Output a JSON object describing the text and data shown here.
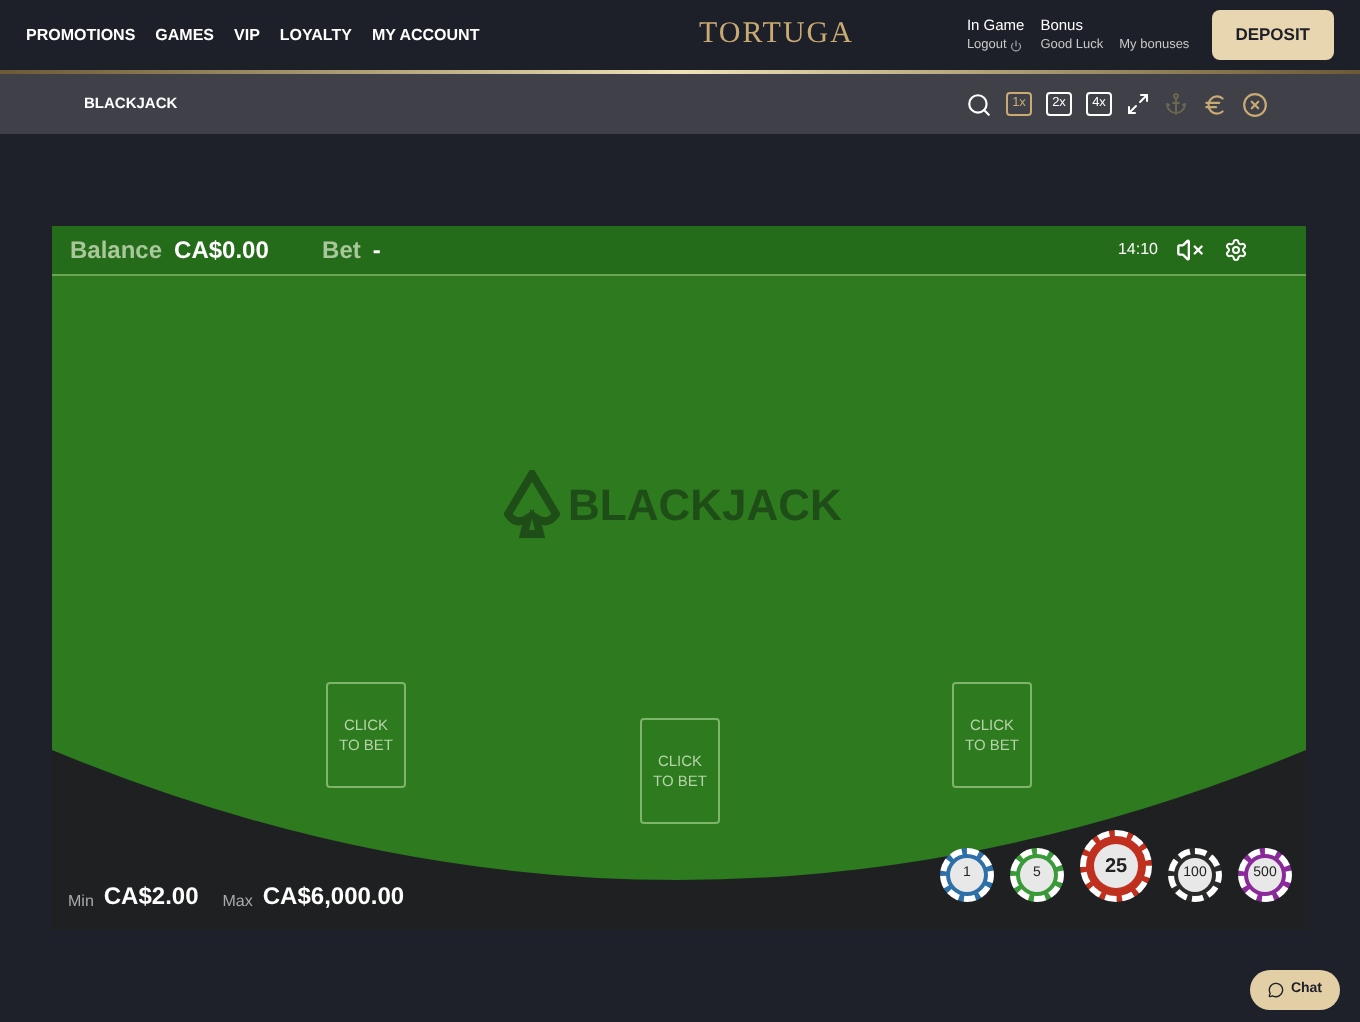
{
  "nav": {
    "links": [
      "PROMOTIONS",
      "GAMES",
      "VIP",
      "LOYALTY",
      "MY ACCOUNT"
    ],
    "logo": "TORTUGA",
    "account": [
      {
        "title": "In Game",
        "sub": "Logout"
      },
      {
        "title": "Bonus",
        "sub": "Good Luck"
      },
      {
        "sub": "My bonuses"
      }
    ],
    "deposit": "DEPOSIT"
  },
  "toolbar": {
    "title": "BLACKJACK",
    "speeds": [
      {
        "label": "1x",
        "selected": true
      },
      {
        "label": "2x",
        "selected": false
      },
      {
        "label": "4x",
        "selected": false
      }
    ]
  },
  "game": {
    "balance_label": "Balance",
    "balance": "CA$0.00",
    "bet_label": "Bet",
    "bet": "-",
    "time": "14:10",
    "logo": "BLACKJACK",
    "spots": [
      {
        "label": "CLICK TO BET"
      },
      {
        "label": "CLICK TO BET"
      },
      {
        "label": "CLICK TO BET"
      }
    ],
    "min_label": "Min",
    "min": "CA$2.00",
    "max_label": "Max",
    "max": "CA$6,000.00",
    "chips": [
      {
        "label": "1",
        "color": "#2f6fa8",
        "selected": false
      },
      {
        "label": "5",
        "color": "#3a9a3a",
        "selected": false
      },
      {
        "label": "25",
        "color": "#c0301f",
        "selected": true
      },
      {
        "label": "100",
        "color": "#2a2a2a",
        "selected": false
      },
      {
        "label": "500",
        "color": "#8a2a9a",
        "selected": false
      }
    ]
  },
  "chat": "Chat"
}
